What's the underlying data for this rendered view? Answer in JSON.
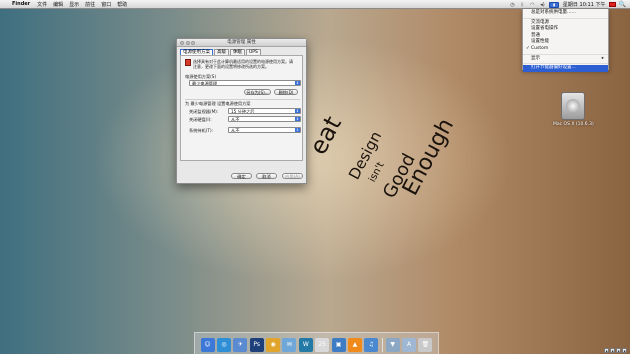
{
  "menubar": {
    "apple": "",
    "app_name": "Finder",
    "items": [
      "文件",
      "编辑",
      "显示",
      "前往",
      "窗口",
      "帮助"
    ],
    "status_icons": [
      "time-machine-icon",
      "bluetooth-icon",
      "wifi-icon",
      "volume-icon",
      "battery-icon"
    ],
    "clock": "星期日 10:11 下午",
    "spotlight": "🔍"
  },
  "power_menu": {
    "items": [
      {
        "label": "总是对系统供电量……",
        "checked": false
      },
      {
        "label": "交流电源",
        "checked": false
      },
      {
        "label": "设置省电操作",
        "checked": false
      },
      {
        "label": "普通",
        "checked": false
      },
      {
        "label": "设置性能",
        "checked": false
      },
      {
        "label": "Custom",
        "checked": true
      },
      {
        "label": "显示",
        "checked": false,
        "submenu": true
      },
      {
        "label": "打开节能器偏好设置...",
        "checked": false,
        "selected": true
      }
    ]
  },
  "window": {
    "title": "电源管理 属性",
    "tabs": [
      "电源使用方案",
      "高级",
      "休眠",
      "UPS"
    ],
    "info_text": "选择具有对于此计算机最适用的设置的电源使用方案。请注意，更改下面的设置将修改所选的方案。",
    "scheme_label": "电源使用方案(S)",
    "scheme_value": "最少电源管理",
    "save_as": "另存为(S)...",
    "delete": "删除(D)",
    "settings_label": "为 最少电源管理 设置电源使用方案",
    "monitor_label": "关闭监视器(M):",
    "monitor_value": "15 分钟之后",
    "harddisk_label": "关闭硬盘(I):",
    "harddisk_value": "从不",
    "standby_label": "系统待机(T):",
    "standby_value": "从不",
    "ok": "确定",
    "cancel": "取消",
    "apply": "应用(A)"
  },
  "wallpaper": {
    "lines": [
      "eat",
      "Design",
      "isn't",
      "Good",
      "Enough"
    ]
  },
  "desktop": {
    "drive_label": "Mac OS X (10.6.3)"
  },
  "dock": {
    "icons": [
      {
        "name": "finder-icon",
        "color": "#3b78d8",
        "glyph": "☺"
      },
      {
        "name": "safari-icon",
        "color": "#2f8fd6",
        "glyph": "◎"
      },
      {
        "name": "app-store-icon",
        "color": "#5a8ad0",
        "glyph": "✈"
      },
      {
        "name": "photoshop-icon",
        "color": "#1d3f7a",
        "glyph": "Ps"
      },
      {
        "name": "chrome-icon",
        "color": "#e0a52a",
        "glyph": "◉"
      },
      {
        "name": "mail-icon",
        "color": "#6fa7d8",
        "glyph": "✉"
      },
      {
        "name": "wordpress-icon",
        "color": "#247aa6",
        "glyph": "W"
      },
      {
        "name": "ical-icon",
        "color": "#d9d9d9",
        "glyph": "25"
      },
      {
        "name": "preview-icon",
        "color": "#3e7cc4",
        "glyph": "▣"
      },
      {
        "name": "vlc-icon",
        "color": "#f08a1a",
        "glyph": "▲"
      },
      {
        "name": "itunes-icon",
        "color": "#4a88d0",
        "glyph": "♫"
      },
      {
        "name": "sep",
        "color": "",
        "glyph": ""
      },
      {
        "name": "downloads-icon",
        "color": "#8ba7c4",
        "glyph": "▼"
      },
      {
        "name": "applications-icon",
        "color": "#9fb7d2",
        "glyph": "A"
      },
      {
        "name": "trash-icon",
        "color": "#c9c9c9",
        "glyph": "🗑"
      }
    ]
  }
}
